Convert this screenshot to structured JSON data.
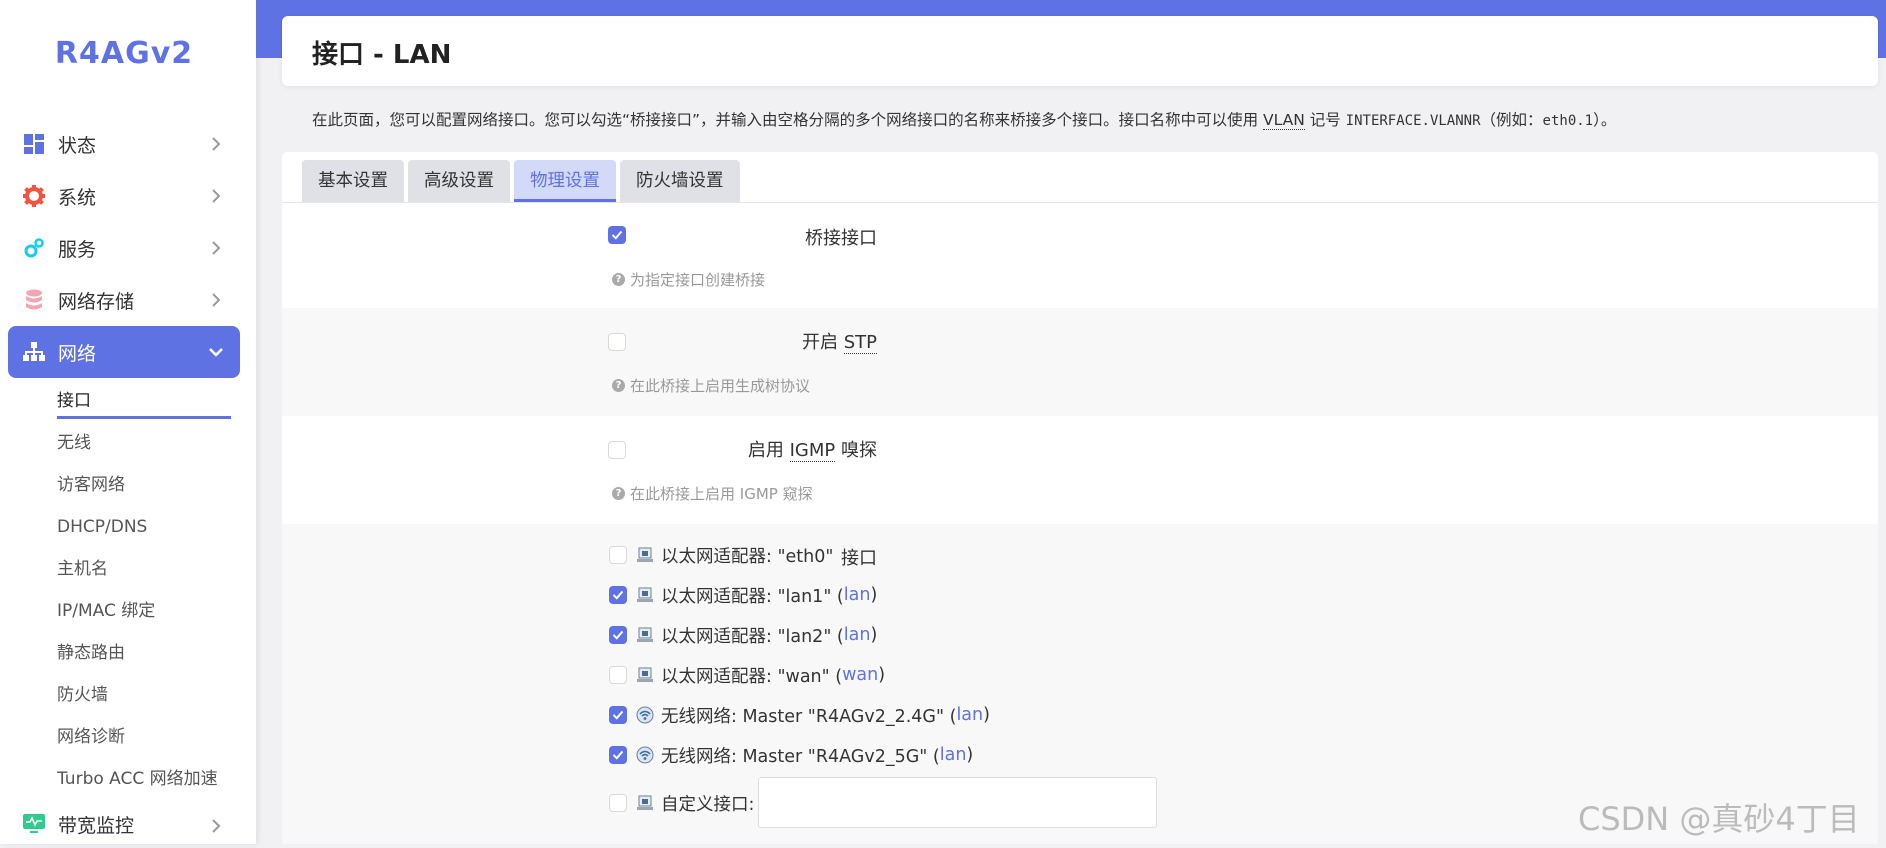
{
  "brand": "R4AGv2",
  "sidebar": {
    "items": [
      {
        "label": "状态",
        "icon": "dashboard-icon"
      },
      {
        "label": "系统",
        "icon": "gear-icon"
      },
      {
        "label": "服务",
        "icon": "cogs-icon"
      },
      {
        "label": "网络存储",
        "icon": "database-icon"
      },
      {
        "label": "网络",
        "icon": "network-icon"
      }
    ],
    "network_submenu": [
      "接口",
      "无线",
      "访客网络",
      "DHCP/DNS",
      "主机名",
      "IP/MAC 绑定",
      "静态路由",
      "防火墙",
      "网络诊断",
      "Turbo ACC 网络加速"
    ],
    "bandwidth": {
      "label": "带宽监控",
      "icon": "monitor-icon"
    }
  },
  "page": {
    "title": "接口 - LAN",
    "desc_part1": "在此页面，您可以配置网络接口。您可以勾选“桥接接口”，并输入由空格分隔的多个网络接口的名称来桥接多个接口。接口名称中可以使用 ",
    "desc_abbr": "VLAN",
    "desc_part2": " 记号 ",
    "desc_mono": "INTERFACE.VLANNR",
    "desc_part3": "（例如：",
    "desc_mono2": "eth0.1",
    "desc_part4": "）。"
  },
  "tabs": [
    "基本设置",
    "高级设置",
    "物理设置",
    "防火墙设置"
  ],
  "form": {
    "bridge": {
      "label": "桥接接口",
      "checked": true,
      "hint": "为指定接口创建桥接"
    },
    "stp": {
      "label_prefix": "开启 ",
      "label_abbr": "STP",
      "checked": false,
      "hint": "在此桥接上启用生成树协议"
    },
    "igmp": {
      "label_prefix": "启用 ",
      "label_abbr": "IGMP",
      "label_suffix": " 嗅探",
      "checked": false,
      "hint": "在此桥接上启用 IGMP 窥探"
    },
    "interfaces": {
      "label": "接口",
      "items": [
        {
          "text": "以太网适配器: \"eth0\"",
          "net": "",
          "checked": false,
          "icon": "ethernet-icon"
        },
        {
          "text": "以太网适配器: \"lan1\" (",
          "net": "lan",
          "close": ")",
          "checked": true,
          "icon": "ethernet-icon"
        },
        {
          "text": "以太网适配器: \"lan2\" (",
          "net": "lan",
          "close": ")",
          "checked": true,
          "icon": "ethernet-icon"
        },
        {
          "text": "以太网适配器: \"wan\" (",
          "net": "wan",
          "close": ")",
          "checked": false,
          "icon": "ethernet-icon"
        },
        {
          "text": "无线网络: Master \"R4AGv2_2.4G\" (",
          "net": "lan",
          "close": ")",
          "checked": true,
          "icon": "wifi-icon"
        },
        {
          "text": "无线网络: Master \"R4AGv2_5G\" (",
          "net": "lan",
          "close": ")",
          "checked": true,
          "icon": "wifi-icon"
        }
      ],
      "custom_label": "自定义接口:",
      "custom_value": ""
    }
  },
  "watermark": "CSDN @真砂4丁目",
  "colors": {
    "accent": "#5e72e4",
    "hint": "#999999",
    "tab_bg": "#dfe1e6"
  }
}
